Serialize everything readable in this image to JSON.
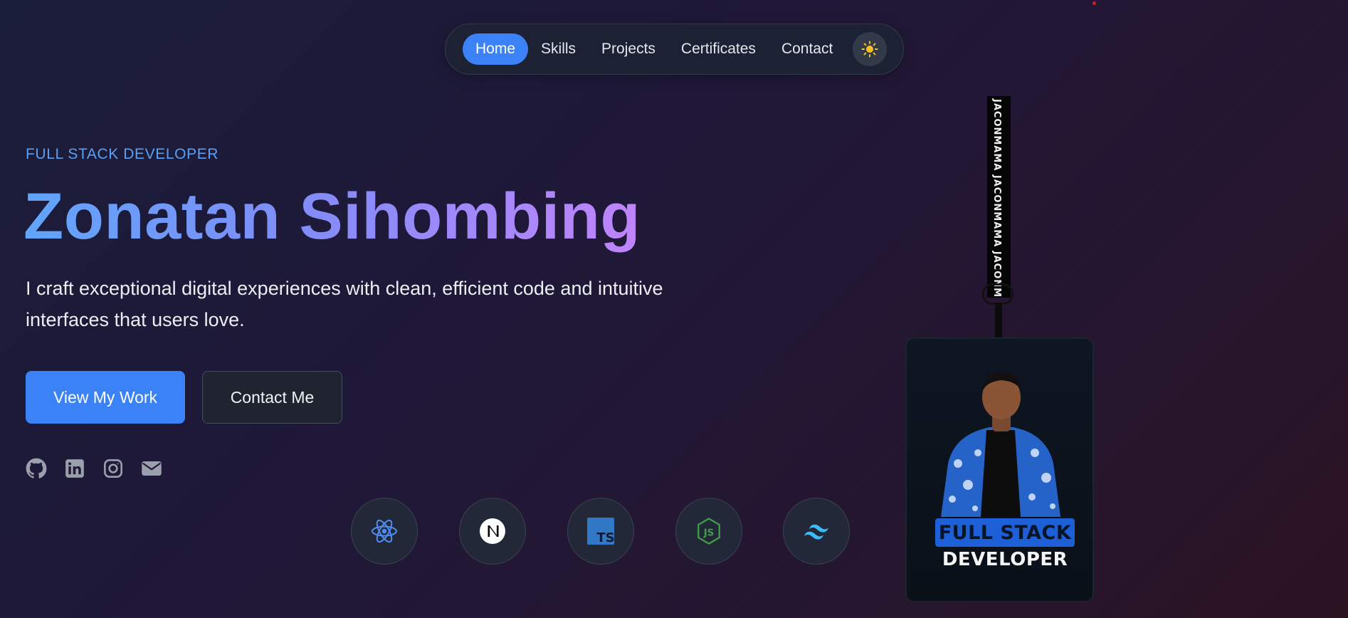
{
  "nav": {
    "items": [
      {
        "label": "Home",
        "active": true
      },
      {
        "label": "Skills",
        "active": false
      },
      {
        "label": "Projects",
        "active": false
      },
      {
        "label": "Certificates",
        "active": false
      },
      {
        "label": "Contact",
        "active": false
      }
    ],
    "theme_toggle_icon": "sun-icon"
  },
  "hero": {
    "subtitle": "FULL STACK DEVELOPER",
    "name": "Zonatan Sihombing",
    "description": "I craft exceptional digital experiences with clean, efficient code and intuitive interfaces that users love.",
    "primary_button": "View My Work",
    "secondary_button": "Contact Me"
  },
  "socials": [
    {
      "icon": "github-icon"
    },
    {
      "icon": "linkedin-icon"
    },
    {
      "icon": "instagram-icon"
    },
    {
      "icon": "mail-icon"
    }
  ],
  "tech_stack": [
    {
      "icon": "react-icon"
    },
    {
      "icon": "nextjs-icon"
    },
    {
      "icon": "typescript-icon"
    },
    {
      "icon": "nodejs-icon"
    },
    {
      "icon": "tailwind-icon"
    }
  ],
  "badge": {
    "strap_text": "JACONMAMA   JACONMAMA   JACONMAMA",
    "title_line_1": "FULL STACK",
    "title_line_2": "DEVELOPER"
  },
  "colors": {
    "accent": "#3b82f6",
    "subtitle": "#5aa0f5",
    "gradient_start": "#60a5fa",
    "gradient_end": "#c084fc"
  }
}
